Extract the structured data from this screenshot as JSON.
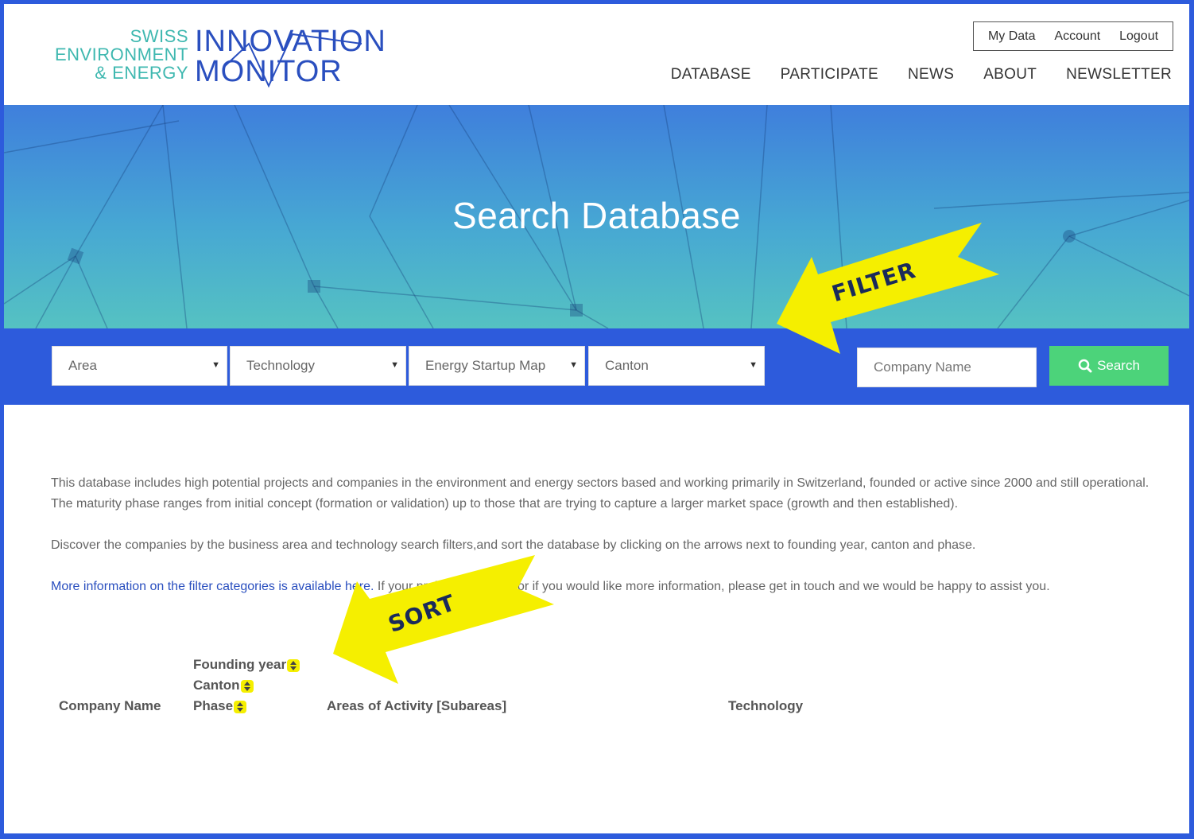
{
  "logo": {
    "line1": "SWISS",
    "line2": "ENVIRONMENT",
    "line3": "& ENERGY",
    "big1": "INNOVATION",
    "big2": "MONITOR"
  },
  "account_links": [
    "My Data",
    "Account",
    "Logout"
  ],
  "nav": [
    "DATABASE",
    "PARTICIPATE",
    "NEWS",
    "ABOUT",
    "NEWSLETTER"
  ],
  "hero": {
    "title": "Search Database"
  },
  "filters": {
    "area": "Area",
    "technology": "Technology",
    "startup_map": "Energy Startup Map",
    "canton": "Canton",
    "company_placeholder": "Company Name",
    "search_label": "Search"
  },
  "content": {
    "p1": "This database includes high potential projects and companies in the environment and energy sectors based and working primarily in Switzerland, founded or active since 2000 and still operational. The maturity phase ranges from initial concept (formation or validation) up to those that are trying to capture a larger market space (growth and then established).",
    "p2": "Discover the companies by the business area and technology search filters,and sort the database by clicking on the arrows next to founding year, canton and phase.",
    "p3_link": "More information on the filter categories is available here.",
    "p3_rest": " If your project is missing or if you would like more information, please get in touch and we would be happy to assist you."
  },
  "table_headers": {
    "company": "Company Name",
    "founding_year": "Founding year",
    "canton": "Canton",
    "phase": "Phase",
    "areas": "Areas of Activity [Subareas]",
    "technology": "Technology"
  },
  "annotations": {
    "filter": "FILTER",
    "sort": "SORT"
  },
  "colors": {
    "frame": "#2d5bdc",
    "filter_bar": "#2d5bdc",
    "search_button": "#4cd37a",
    "annotation": "#f5ef00",
    "link": "#2a4fbf"
  }
}
